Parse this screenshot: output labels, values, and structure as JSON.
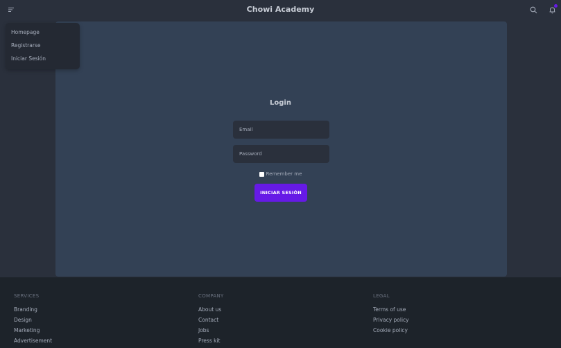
{
  "navbar": {
    "title": "Chowi Academy",
    "menu_icon": "menu-icon",
    "search_icon": "search-icon",
    "bell_icon": "bell-icon",
    "accent_color": "#661ae6"
  },
  "dropdown": {
    "items": [
      {
        "label": "Homepage"
      },
      {
        "label": "Registrarse"
      },
      {
        "label": "Iniciar Sesión"
      }
    ]
  },
  "login": {
    "title": "Login",
    "email_placeholder": "Email",
    "password_placeholder": "Password",
    "remember_label": "Remember me",
    "submit_label": "INICIAR SESIÓN"
  },
  "footer": {
    "columns": [
      {
        "heading": "SERVICES",
        "links": [
          "Branding",
          "Design",
          "Marketing",
          "Advertisement"
        ]
      },
      {
        "heading": "COMPANY",
        "links": [
          "About us",
          "Contact",
          "Jobs",
          "Press kit"
        ]
      },
      {
        "heading": "LEGAL",
        "links": [
          "Terms of use",
          "Privacy policy",
          "Cookie policy"
        ]
      }
    ]
  }
}
